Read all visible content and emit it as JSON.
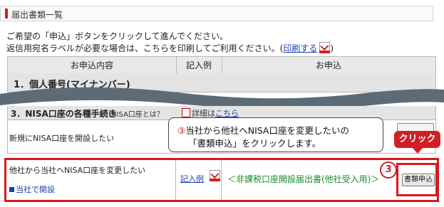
{
  "section": {
    "title": "届出書類一覧"
  },
  "intro": {
    "line1": "ご希望の「申込」ボタンをクリックして進んでください。",
    "line2_prefix": "返信用宛名ラベルが必要な場合は、こちらを印刷してご利用ください。(",
    "line2_link": "印刷する",
    "line2_suffix": ")"
  },
  "table": {
    "headers": [
      "お申込内容",
      "記入例",
      "お申込"
    ],
    "category1": "1．個人番号(マイナンバー)",
    "category3": "3．NISA口座の各種手続き",
    "nisa_question": "（NISA口座とは？",
    "detail_prefix": "詳細は",
    "detail_link": "こちら",
    "row_new": {
      "label": "新規にNISA口座を開設したい"
    },
    "row_transfer": {
      "label": "他社から当社へNISA口座を変更したい",
      "sublink": "当社で開設",
      "example_link": "記入例",
      "form_name": "＜非課税口座開設届出書(他社受入用)＞",
      "apply_button": "書類申込"
    }
  },
  "callout": {
    "number": "③",
    "line1": "当社から他社へNISA口座を変更したいの",
    "line2": "「書類申込」をクリックします。"
  },
  "click_badge": "クリック",
  "step_number": "3",
  "colors": {
    "accent_red": "#d01f27",
    "link_blue": "#1a3fb5",
    "form_green": "#1a8a2c"
  }
}
